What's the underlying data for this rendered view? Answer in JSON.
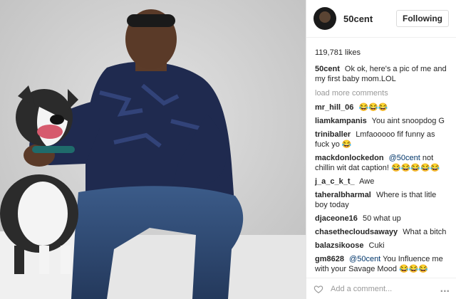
{
  "post": {
    "username": "50cent",
    "follow_label": "Following",
    "likes": "119,781 likes",
    "caption": "Ok ok, here's a pic of me and my first baby mom.LOL",
    "load_more": "load more comments",
    "add_comment_placeholder": "Add a comment...",
    "more_label": "..."
  },
  "comments": [
    {
      "user": "mr_hill_06",
      "text": "😂😂😂"
    },
    {
      "user": "liamkampanis",
      "text": "You aint snoopdog G"
    },
    {
      "user": "triniballer",
      "text": "Lmfaooooo fif funny as fuck yo 😂"
    },
    {
      "user": "mackdonlockedon",
      "mention": "@50cent",
      "text": "not chillin wit dat caption! 😂😂😂😂😂"
    },
    {
      "user": "j_a_c_k_t_",
      "text": "Awe"
    },
    {
      "user": "taheralbharmal",
      "text": "Where is that litle boy today"
    },
    {
      "user": "djaceone16",
      "text": "50 what up"
    },
    {
      "user": "chasethecloudsawayy",
      "text": "What a bitch"
    },
    {
      "user": "balazsikoose",
      "text": "Cuki"
    },
    {
      "user": "gm8628",
      "mention": "@50cent",
      "text": "You Influence me with your Savage Mood 😂😂😂"
    }
  ],
  "icons": {
    "heart": "heart-outline-icon",
    "more": "more-options-icon"
  },
  "colors": {
    "mention": "#003569",
    "muted": "#999999"
  }
}
